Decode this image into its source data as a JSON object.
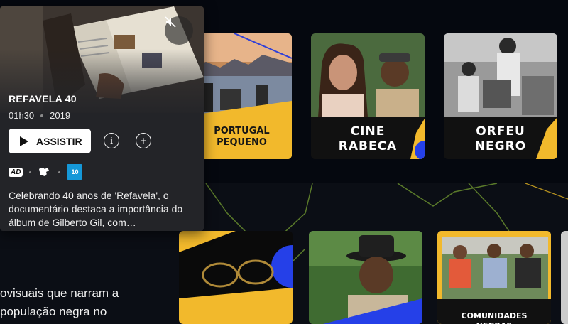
{
  "catalog": {
    "row1": [
      {
        "title": "PORTUGAL PEQUENO",
        "accent": "#f2b92c"
      },
      {
        "title": "CINE RABECA",
        "accent": "#2540e8"
      },
      {
        "title": "ORFEU NEGRO",
        "accent": "#f2b92c"
      }
    ],
    "row2": [
      {
        "title": ""
      },
      {
        "title": ""
      },
      {
        "title": "COMUNIDADES NEGRAS"
      }
    ]
  },
  "side_text": "ovisuais que narram a população negra no",
  "popup": {
    "title": "REFAVELA 40",
    "duration": "01h30",
    "year": "2019",
    "watch_label": "ASSISTIR",
    "ad_label": "AD",
    "rating": "10",
    "synopsis": "Celebrando 40 anos de 'Refavela', o documentário destaca a importância do álbum de Gilberto Gil, com…",
    "icons": {
      "mute": "volume-off-icon",
      "play": "play-icon",
      "info": "info-icon",
      "add": "add-icon",
      "sign_language": "sign-language-icon"
    }
  },
  "colors": {
    "background": "#05080f",
    "yellow": "#f2b92c",
    "blue": "#2540e8",
    "rating_blue": "#1598d8"
  }
}
